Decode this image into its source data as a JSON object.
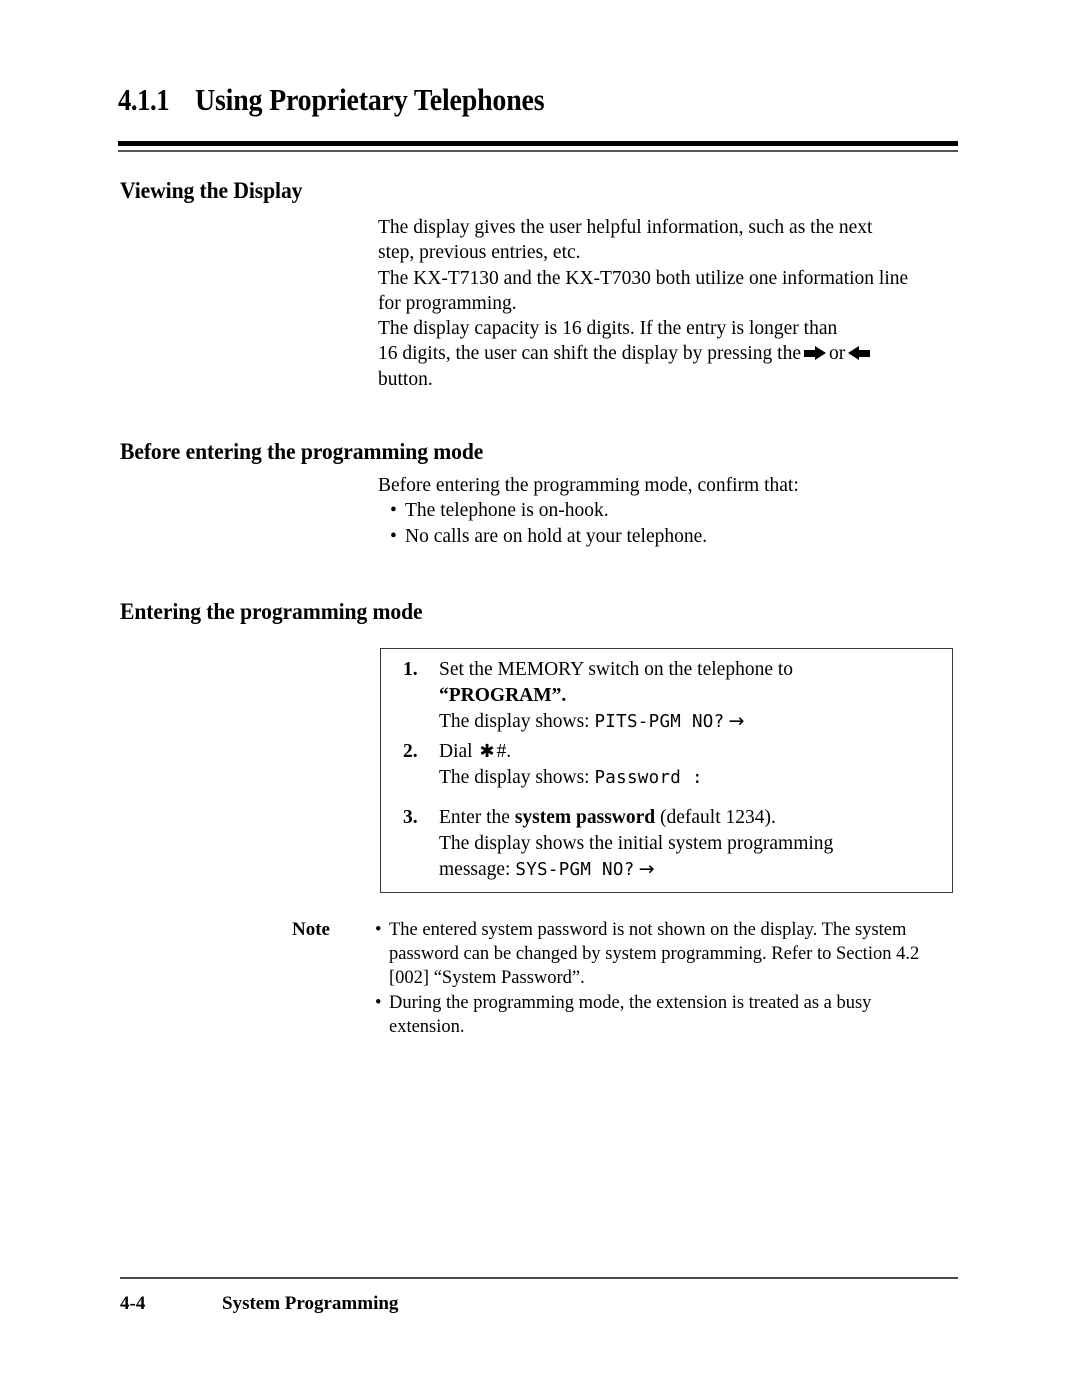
{
  "title": {
    "number": "4.1.1",
    "text": "Using Proprietary Telephones"
  },
  "sections": {
    "viewing": {
      "heading": "Viewing the Display",
      "lines": [
        "The display gives the user helpful information, such as the next",
        "step, previous entries, etc.",
        "The KX-T7130 and the KX-T7030 both utilize one information line",
        "for programming.",
        "The display capacity is 16 digits. If the entry is longer than"
      ],
      "shift_line_before": "16 digits, the user can shift the display by pressing the",
      "shift_line_or": "or",
      "shift_line_after": "button."
    },
    "before": {
      "heading": "Before entering the programming mode",
      "intro": "Before entering the programming mode, confirm that:",
      "bullets": [
        "The telephone is on-hook.",
        "No calls are on hold at your telephone."
      ]
    },
    "entering": {
      "heading": "Entering the programming mode",
      "steps": [
        {
          "num": "1.",
          "line1": "Set the MEMORY switch on the telephone to",
          "line2_bold": "“PROGRAM”.",
          "line3_label": "The display shows:",
          "line3_mono": "PITS-PGM NO?",
          "line3_arrow": "→"
        },
        {
          "num": "2.",
          "line1_pre": "Dial",
          "line1_star": "✱",
          "line1_post": "#.",
          "line2_label": "The display shows:",
          "line2_mono": "Password :"
        },
        {
          "num": "3.",
          "line1_pre": "Enter the",
          "line1_bold": "system password",
          "line1_post": "(default 1234).",
          "line2": "The display shows the initial system programming",
          "line3_label": "message:",
          "line3_mono": "SYS-PGM NO?",
          "line3_arrow": "→"
        }
      ]
    },
    "note": {
      "label": "Note",
      "items": [
        [
          "The entered system password is not shown on the display. The system",
          "password can be changed by system programming. Refer to Section 4.2",
          "[002] “System Password”."
        ],
        [
          "During the programming mode, the extension is treated as a busy",
          "extension."
        ]
      ]
    }
  },
  "footer": {
    "page_number": "4-4",
    "title": "System Programming"
  }
}
